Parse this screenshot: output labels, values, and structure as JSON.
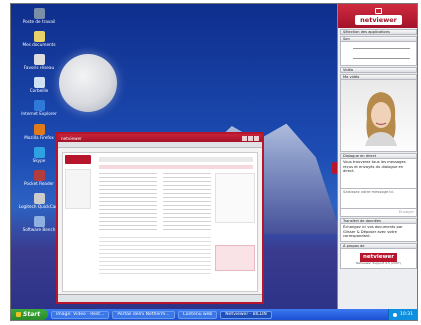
{
  "desktop": {
    "icons": [
      {
        "label": "Poste de travail",
        "color": "#7a8ea8"
      },
      {
        "label": "Mes documents",
        "color": "#e9d06a"
      },
      {
        "label": "Favoris réseau",
        "color": "#dddddd"
      },
      {
        "label": "Corbeille",
        "color": "#cfe2f3"
      },
      {
        "label": "Internet Explorer",
        "color": "#2f7ad9"
      },
      {
        "label": "Mozilla Firefox",
        "color": "#e07a1b"
      },
      {
        "label": "Skype",
        "color": "#2fa0e0"
      },
      {
        "label": "Pocket Reader",
        "color": "#b33c3c"
      },
      {
        "label": "Logitech QuickCam",
        "color": "#cccccc"
      },
      {
        "label": "Software Bench",
        "color": "#8fb0e0"
      }
    ]
  },
  "taskbar": {
    "start_label": "Start",
    "buttons": [
      "Image: Video - Rest...",
      "Portail demi Netfierm...",
      "Contenu web"
    ],
    "active_button": "Netviewer - BILLIN",
    "time": "10:31"
  },
  "browser_window": {
    "title": "netviewer",
    "status": "Gerne auf Netviewer"
  },
  "netviewer_panel": {
    "logo": "netviewer",
    "sections": {
      "apps": "Sélection des applications",
      "sound": "Son",
      "video": "Vidéo",
      "my_video": "Ma vidéo",
      "chat": "Dialogue en direct",
      "file_transfer": "Transfert de données",
      "about": "À propos de"
    },
    "chat_text": "Vous trouverez tous les messages reçus et envoyés du dialogue en direct.",
    "chat_input_placeholder": "Saisissez votre message ici.",
    "send_label": "Envoyer",
    "transfer_text": "Échangez ici vos documents par Glisser & Déposer avec votre correspondant.",
    "about_logo": "netviewer",
    "about_sub": "Netviewer Support 4.5 (2007)"
  }
}
